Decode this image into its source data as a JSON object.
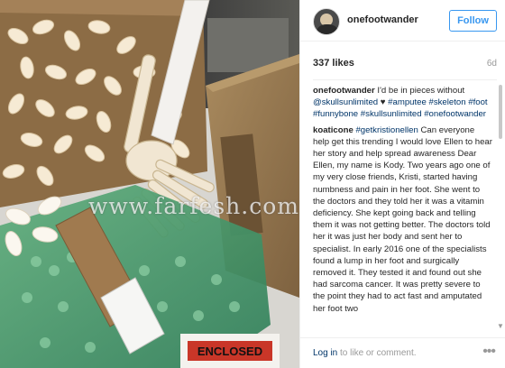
{
  "photo": {
    "alt_subject": "skeleton foot in box with packing peanuts",
    "label_text": "ENCLOSED",
    "watermark": "www.farfesh.com"
  },
  "post": {
    "username": "onefootwander",
    "follow_label": "Follow",
    "likes": "337 likes",
    "time": "6d"
  },
  "caption": {
    "author": "onefootwander",
    "text_before": " I'd be in pieces without ",
    "mention": "@skullsunlimited",
    "heart": "♥",
    "hashtags": "#amputee #skeleton #foot #funnybone #skullsunlimited #onefootwander"
  },
  "comment": {
    "author": "koaticone",
    "hashtag": "#getkristionellen",
    "lines": [
      "Can everyone help get this trending I would love Ellen to hear her story and help spread awareness",
      "Dear Ellen, my name is Kody. Two years ago one of my very close friends, Kristi, started having numbness and pain in her foot. She went to the doctors and they told her it was a vitamin deficiency. She kept going back and telling them it was not getting better. The doctors told her it was just her body and sent her to specialist. In early 2016 one of the specialists found a lump in her foot and surgically removed it. They tested it and found out she had sarcoma cancer. It was pretty severe to the point they had to act fast and amputated her foot two"
    ]
  },
  "footer": {
    "login_link": "Log in",
    "rest": " to like or comment.",
    "more": "•••"
  },
  "colors": {
    "link": "#003569",
    "follow_blue": "#3897f0",
    "muted": "#999999"
  }
}
